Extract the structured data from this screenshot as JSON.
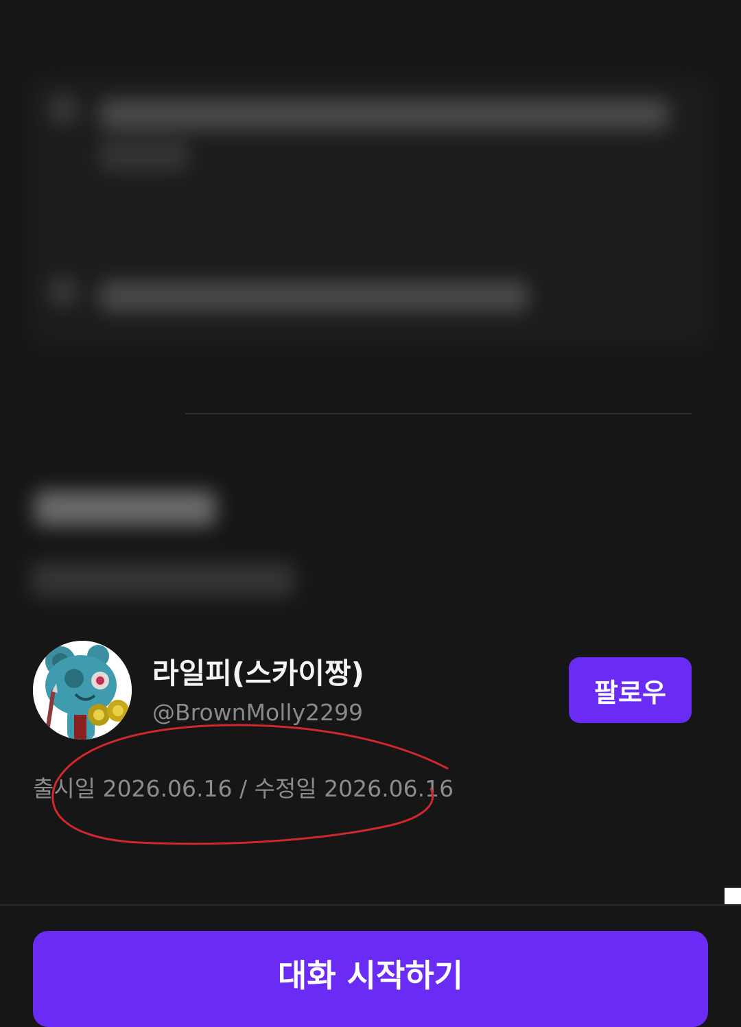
{
  "creator": {
    "name": "라일피(스카이짱)",
    "handle": "@BrownMolly2299",
    "follow_label": "팔로우"
  },
  "dates": {
    "text": "출시일 2026.06.16 / 수정일 2026.06.16"
  },
  "actions": {
    "start_chat_label": "대화 시작하기"
  },
  "colors": {
    "background": "#161616",
    "accent": "#6a2cf5",
    "annotation": "#d1282c"
  }
}
